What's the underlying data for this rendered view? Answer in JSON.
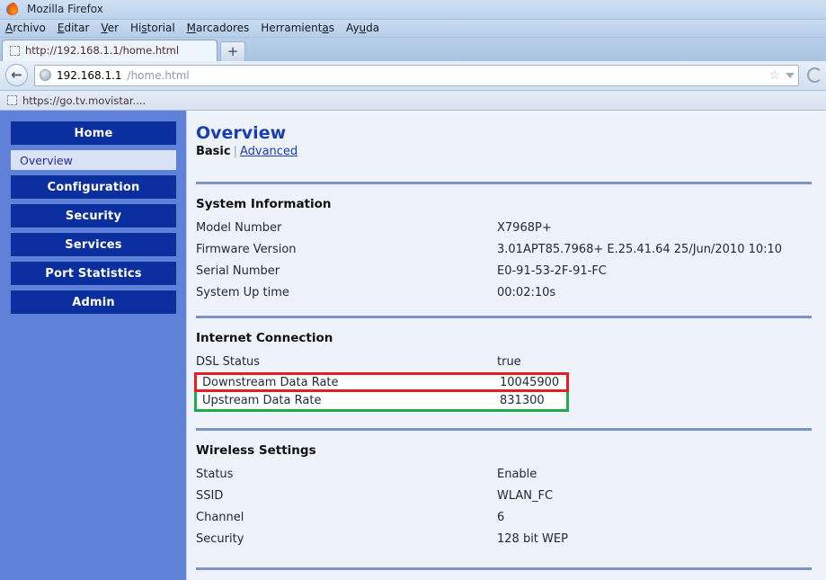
{
  "browser": {
    "window_title": "Mozilla Firefox",
    "app_icon": "firefox-icon",
    "menus": [
      {
        "pre": "",
        "key": "A",
        "post": "rchivo"
      },
      {
        "pre": "",
        "key": "E",
        "post": "ditar"
      },
      {
        "pre": "",
        "key": "V",
        "post": "er"
      },
      {
        "pre": "Hi",
        "key": "s",
        "post": "torial"
      },
      {
        "pre": "",
        "key": "M",
        "post": "arcadores"
      },
      {
        "pre": "Herramient",
        "key": "a",
        "post": "s"
      },
      {
        "pre": "Ay",
        "key": "u",
        "post": "da"
      }
    ],
    "tab": {
      "title": "http://192.168.1.1/home.html",
      "favicon": "placeholder-favicon"
    },
    "new_tab_label": "+",
    "back_button_glyph": "←",
    "url": {
      "host": "192.168.1.1",
      "path": "/home.html"
    },
    "bookmark": {
      "label": "https://go.tv.movistar....",
      "favicon": "placeholder-favicon"
    }
  },
  "router": {
    "sidebar": [
      {
        "type": "button",
        "label": "Home"
      },
      {
        "type": "sub",
        "label": "Overview"
      },
      {
        "type": "button",
        "label": "Configuration"
      },
      {
        "type": "button",
        "label": "Security"
      },
      {
        "type": "button",
        "label": "Services"
      },
      {
        "type": "button",
        "label": "Port Statistics"
      },
      {
        "type": "button",
        "label": "Admin"
      }
    ],
    "page_title": "Overview",
    "breadcrumb": {
      "basic": "Basic",
      "separator": "|",
      "advanced": "Advanced"
    },
    "sections": [
      {
        "title": "System Information",
        "rows": [
          {
            "label": "Model Number",
            "value": "X7968P+",
            "highlight": "none"
          },
          {
            "label": "Firmware Version",
            "value": "3.01APT85.7968+ E.25.41.64 25/Jun/2010 10:10",
            "highlight": "none"
          },
          {
            "label": "Serial Number",
            "value": "E0-91-53-2F-91-FC",
            "highlight": "none"
          },
          {
            "label": "System Up time",
            "value": "00:02:10s",
            "highlight": "none"
          }
        ]
      },
      {
        "title": "Internet Connection",
        "rows": [
          {
            "label": "DSL Status",
            "value": "true",
            "highlight": "none"
          },
          {
            "label": "Downstream Data Rate",
            "value": "10045900",
            "highlight": "red"
          },
          {
            "label": "Upstream Data Rate",
            "value": "831300",
            "highlight": "green"
          }
        ]
      },
      {
        "title": "Wireless Settings",
        "rows": [
          {
            "label": "Status",
            "value": "Enable",
            "highlight": "none"
          },
          {
            "label": "SSID",
            "value": "WLAN_FC",
            "highlight": "none"
          },
          {
            "label": "Channel",
            "value": "6",
            "highlight": "none"
          },
          {
            "label": "Security",
            "value": "128 bit WEP",
            "highlight": "none"
          }
        ]
      }
    ]
  },
  "colors": {
    "sidebar_bg": "#6081d8",
    "nav_button": "#0b2f9e",
    "content_bg": "#eef2fa",
    "title_blue": "#1a3fb5",
    "rule": "#7b94c9",
    "highlight_red": "#e81c23",
    "highlight_green": "#1faa4b"
  }
}
